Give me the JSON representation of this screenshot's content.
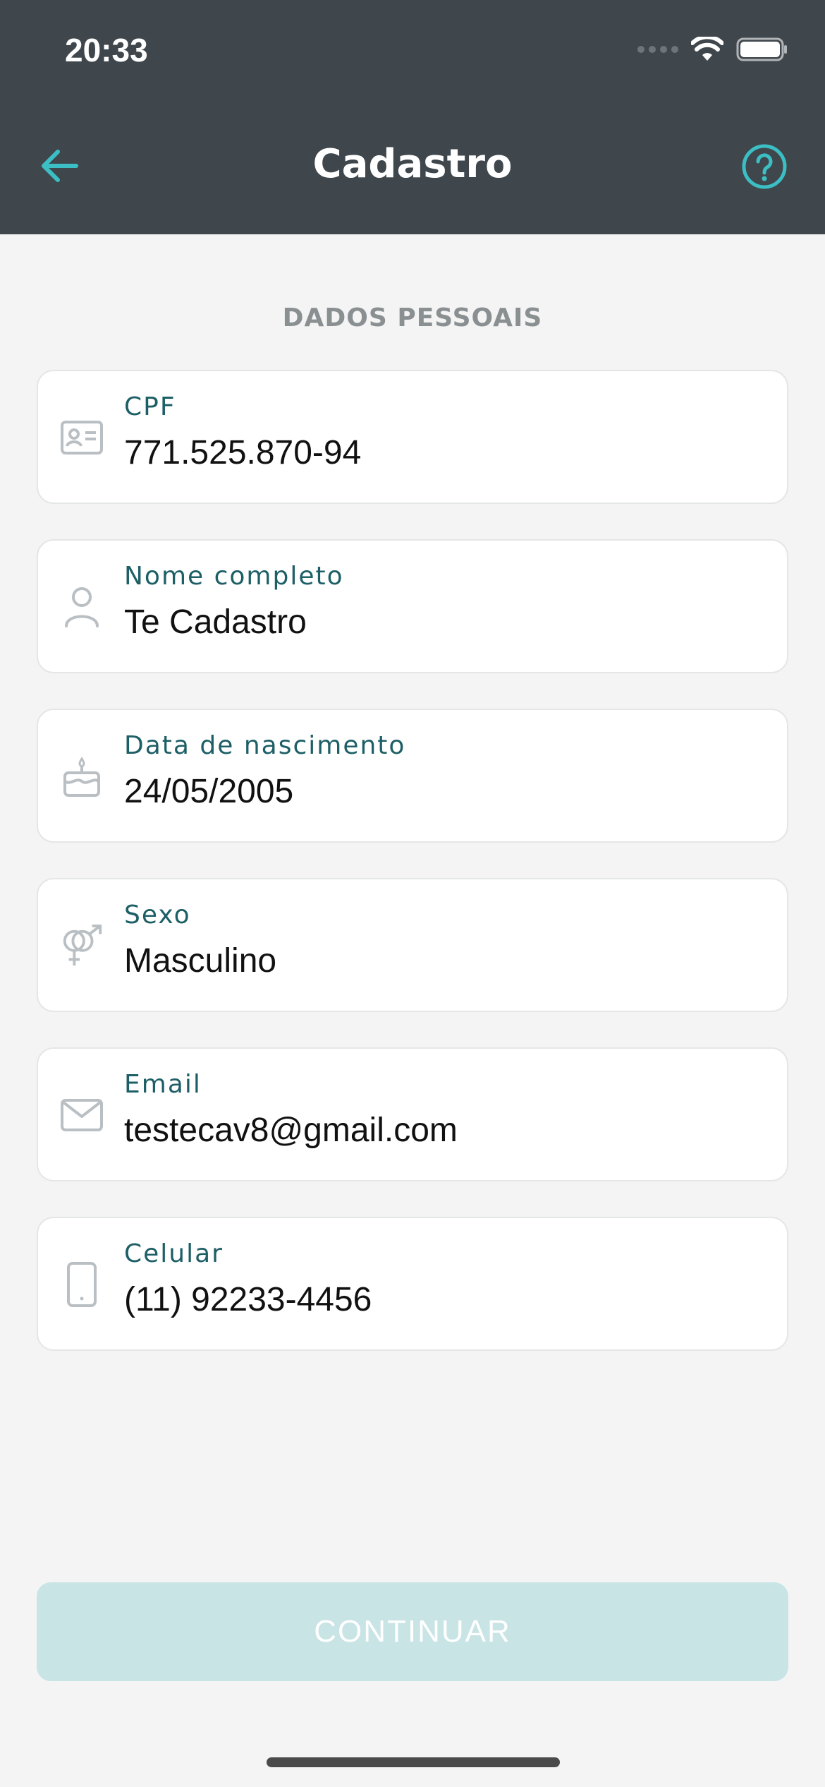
{
  "status_bar": {
    "time": "20:33"
  },
  "header": {
    "title": "Cadastro",
    "back_icon": "arrow-left-icon",
    "help_icon": "help-circle-icon",
    "accent": "#3bbfc4"
  },
  "section": {
    "title": "DADOS PESSOAIS"
  },
  "fields": [
    {
      "label": "CPF",
      "value": "771.525.870-94",
      "icon": "id-card-icon"
    },
    {
      "label": "Nome completo",
      "value": "Te Cadastro",
      "icon": "user-icon"
    },
    {
      "label": "Data de nascimento",
      "value": "24/05/2005",
      "icon": "birthday-cake-icon"
    },
    {
      "label": "Sexo",
      "value": "Masculino",
      "icon": "gender-icon"
    },
    {
      "label": "Email",
      "value": "testecav8@gmail.com",
      "icon": "envelope-icon"
    },
    {
      "label": "Celular",
      "value": "(11) 92233-4456",
      "icon": "phone-icon"
    }
  ],
  "actions": {
    "continue_label": "CONTINUAR"
  }
}
